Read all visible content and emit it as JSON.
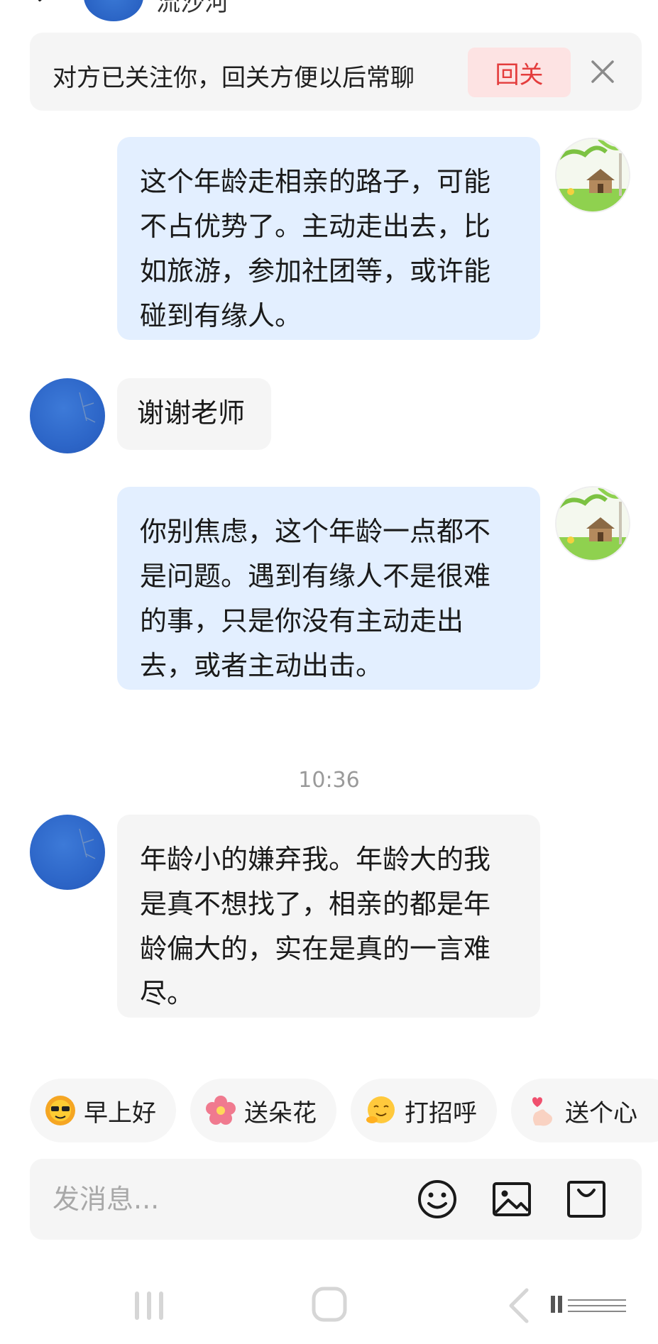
{
  "header": {
    "contact_name": "流沙河"
  },
  "follow_banner": {
    "text": "对方已关注你，回关方便以后常聊",
    "button_label": "回关"
  },
  "messages": [
    {
      "sender": "me",
      "text": "这个年龄走相亲的路子，可能不占优势了。主动走出去，比如旅游，参加社团等，或许能碰到有缘人。"
    },
    {
      "sender": "them",
      "text": "谢谢老师"
    },
    {
      "sender": "me",
      "text": "你别焦虑，这个年龄一点都不是问题。遇到有缘人不是很难的事，只是你没有主动走出去，或者主动出击。"
    },
    {
      "sender": "them",
      "text": "年龄小的嫌弃我。年龄大的我是真不想找了，相亲的都是年龄偏大的，实在是真的一言难尽。"
    }
  ],
  "timestamp": "10:36",
  "quick_replies": [
    {
      "label": "早上好",
      "icon": "sunglasses-sun-emoji-icon"
    },
    {
      "label": "送朵花",
      "icon": "flower-emoji-icon"
    },
    {
      "label": "打招呼",
      "icon": "smiling-hug-emoji-icon"
    },
    {
      "label": "送个心",
      "icon": "finger-heart-emoji-icon"
    }
  ],
  "composer": {
    "placeholder": "发消息..."
  },
  "colors": {
    "my_bubble": "#e3efff",
    "their_bubble": "#f5f5f5",
    "follow_button_bg": "#fde3e3",
    "follow_button_text": "#e43d3d"
  }
}
